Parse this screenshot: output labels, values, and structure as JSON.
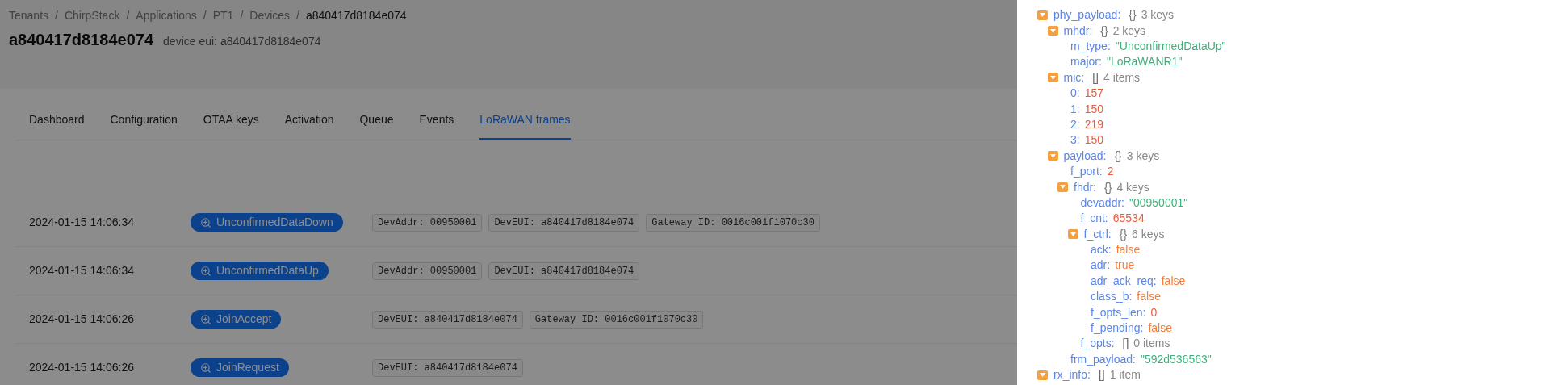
{
  "breadcrumb": [
    {
      "label": "Tenants"
    },
    {
      "label": "ChirpStack"
    },
    {
      "label": "Applications"
    },
    {
      "label": "PT1"
    },
    {
      "label": "Devices"
    },
    {
      "label": "a840417d8184e074"
    }
  ],
  "breadcrumb_separator": "/",
  "title": "a840417d8184e074",
  "subtitle": "device eui: a840417d8184e074",
  "tabs": [
    {
      "label": "Dashboard",
      "selected": false
    },
    {
      "label": "Configuration",
      "selected": false
    },
    {
      "label": "OTAA keys",
      "selected": false
    },
    {
      "label": "Activation",
      "selected": false
    },
    {
      "label": "Queue",
      "selected": false
    },
    {
      "label": "Events",
      "selected": false
    },
    {
      "label": "LoRaWAN frames",
      "selected": true
    }
  ],
  "frames": [
    {
      "time": "2024-01-15 14:06:34",
      "type": "UnconfirmedDataDown",
      "tags": [
        "DevAddr: 00950001",
        "DevEUI: a840417d8184e074",
        "Gateway ID: 0016c001f1070c30"
      ]
    },
    {
      "time": "2024-01-15 14:06:34",
      "type": "UnconfirmedDataUp",
      "tags": [
        "DevAddr: 00950001",
        "DevEUI: a840417d8184e074"
      ]
    },
    {
      "time": "2024-01-15 14:06:26",
      "type": "JoinAccept",
      "tags": [
        "DevEUI: a840417d8184e074",
        "Gateway ID: 0016c001f1070c30"
      ]
    },
    {
      "time": "2024-01-15 14:06:26",
      "type": "JoinRequest",
      "tags": [
        "DevEUI: a840417d8184e074"
      ]
    }
  ],
  "drawer": {
    "tree": [
      {
        "key": "phy_payload:",
        "kind": "object",
        "brackets": "{}",
        "count": "3 keys",
        "expanded": true,
        "children": [
          {
            "key": "mhdr:",
            "kind": "object",
            "brackets": "{}",
            "count": "2 keys",
            "expanded": true,
            "children": [
              {
                "key": "m_type:",
                "kind": "string",
                "value": "\"UnconfirmedDataUp\""
              },
              {
                "key": "major:",
                "kind": "string",
                "value": "\"LoRaWANR1\""
              }
            ]
          },
          {
            "key": "mic:",
            "kind": "array",
            "brackets": "[]",
            "count": "4 items",
            "expanded": true,
            "children": [
              {
                "key": "0:",
                "kind": "number",
                "value": "157"
              },
              {
                "key": "1:",
                "kind": "number",
                "value": "150"
              },
              {
                "key": "2:",
                "kind": "number",
                "value": "219"
              },
              {
                "key": "3:",
                "kind": "number",
                "value": "150"
              }
            ]
          },
          {
            "key": "payload:",
            "kind": "object",
            "brackets": "{}",
            "count": "3 keys",
            "expanded": true,
            "children": [
              {
                "key": "f_port:",
                "kind": "number",
                "value": "2"
              },
              {
                "key": "fhdr:",
                "kind": "object",
                "brackets": "{}",
                "count": "4 keys",
                "expanded": true,
                "children": [
                  {
                    "key": "devaddr:",
                    "kind": "string",
                    "value": "\"00950001\""
                  },
                  {
                    "key": "f_cnt:",
                    "kind": "number",
                    "value": "65534"
                  },
                  {
                    "key": "f_ctrl:",
                    "kind": "object",
                    "brackets": "{}",
                    "count": "6 keys",
                    "expanded": true,
                    "children": [
                      {
                        "key": "ack:",
                        "kind": "boolean",
                        "value": "false"
                      },
                      {
                        "key": "adr:",
                        "kind": "boolean",
                        "value": "true"
                      },
                      {
                        "key": "adr_ack_req:",
                        "kind": "boolean",
                        "value": "false"
                      },
                      {
                        "key": "class_b:",
                        "kind": "boolean",
                        "value": "false"
                      },
                      {
                        "key": "f_opts_len:",
                        "kind": "number",
                        "value": "0"
                      },
                      {
                        "key": "f_pending:",
                        "kind": "boolean",
                        "value": "false"
                      }
                    ]
                  },
                  {
                    "key": "f_opts:",
                    "kind": "leafarray",
                    "brackets": "[]",
                    "count": "0 items"
                  }
                ]
              },
              {
                "key": "frm_payload:",
                "kind": "string",
                "value": "\"592d536563\""
              }
            ]
          }
        ]
      },
      {
        "key": "rx_info:",
        "kind": "array",
        "brackets": "[]",
        "count": "1 item",
        "expanded": true
      }
    ]
  }
}
